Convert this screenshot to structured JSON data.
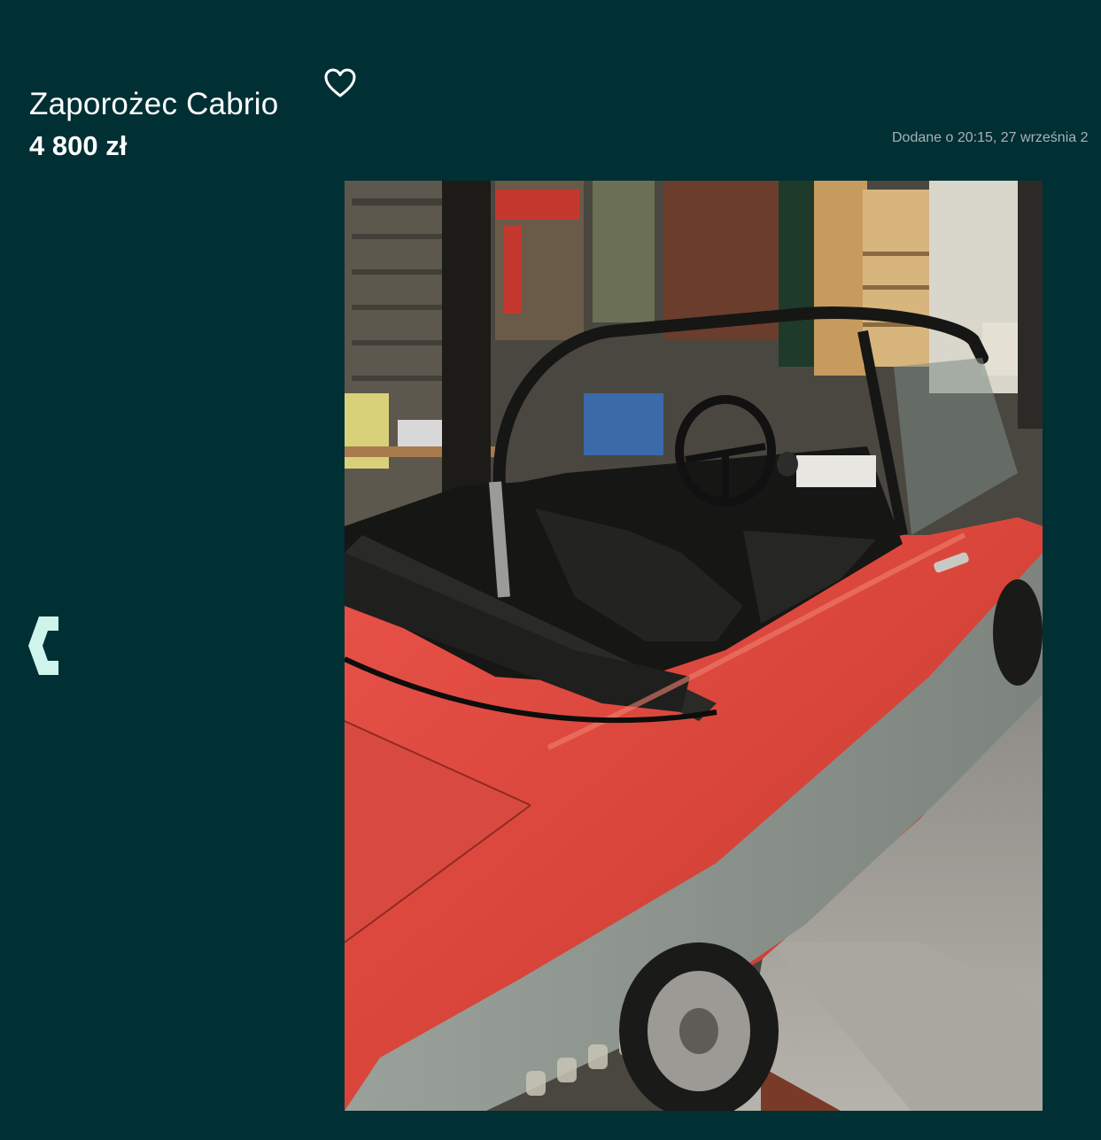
{
  "listing": {
    "title": "Zaporożec Cabrio",
    "price": "4 800 zł",
    "posted": "Dodane o 20:15, 27 września 2"
  },
  "icons": {
    "favorite": "heart-outline-icon",
    "previous": "chevron-left-icon"
  },
  "gallery": {
    "image_alt": "Zaporożec Cabrio"
  },
  "colors": {
    "background": "#002f34",
    "text": "#ffffff",
    "muted_text": "#a6b4b6",
    "accent": "#cef4ec",
    "car_red": "#d9453a"
  }
}
